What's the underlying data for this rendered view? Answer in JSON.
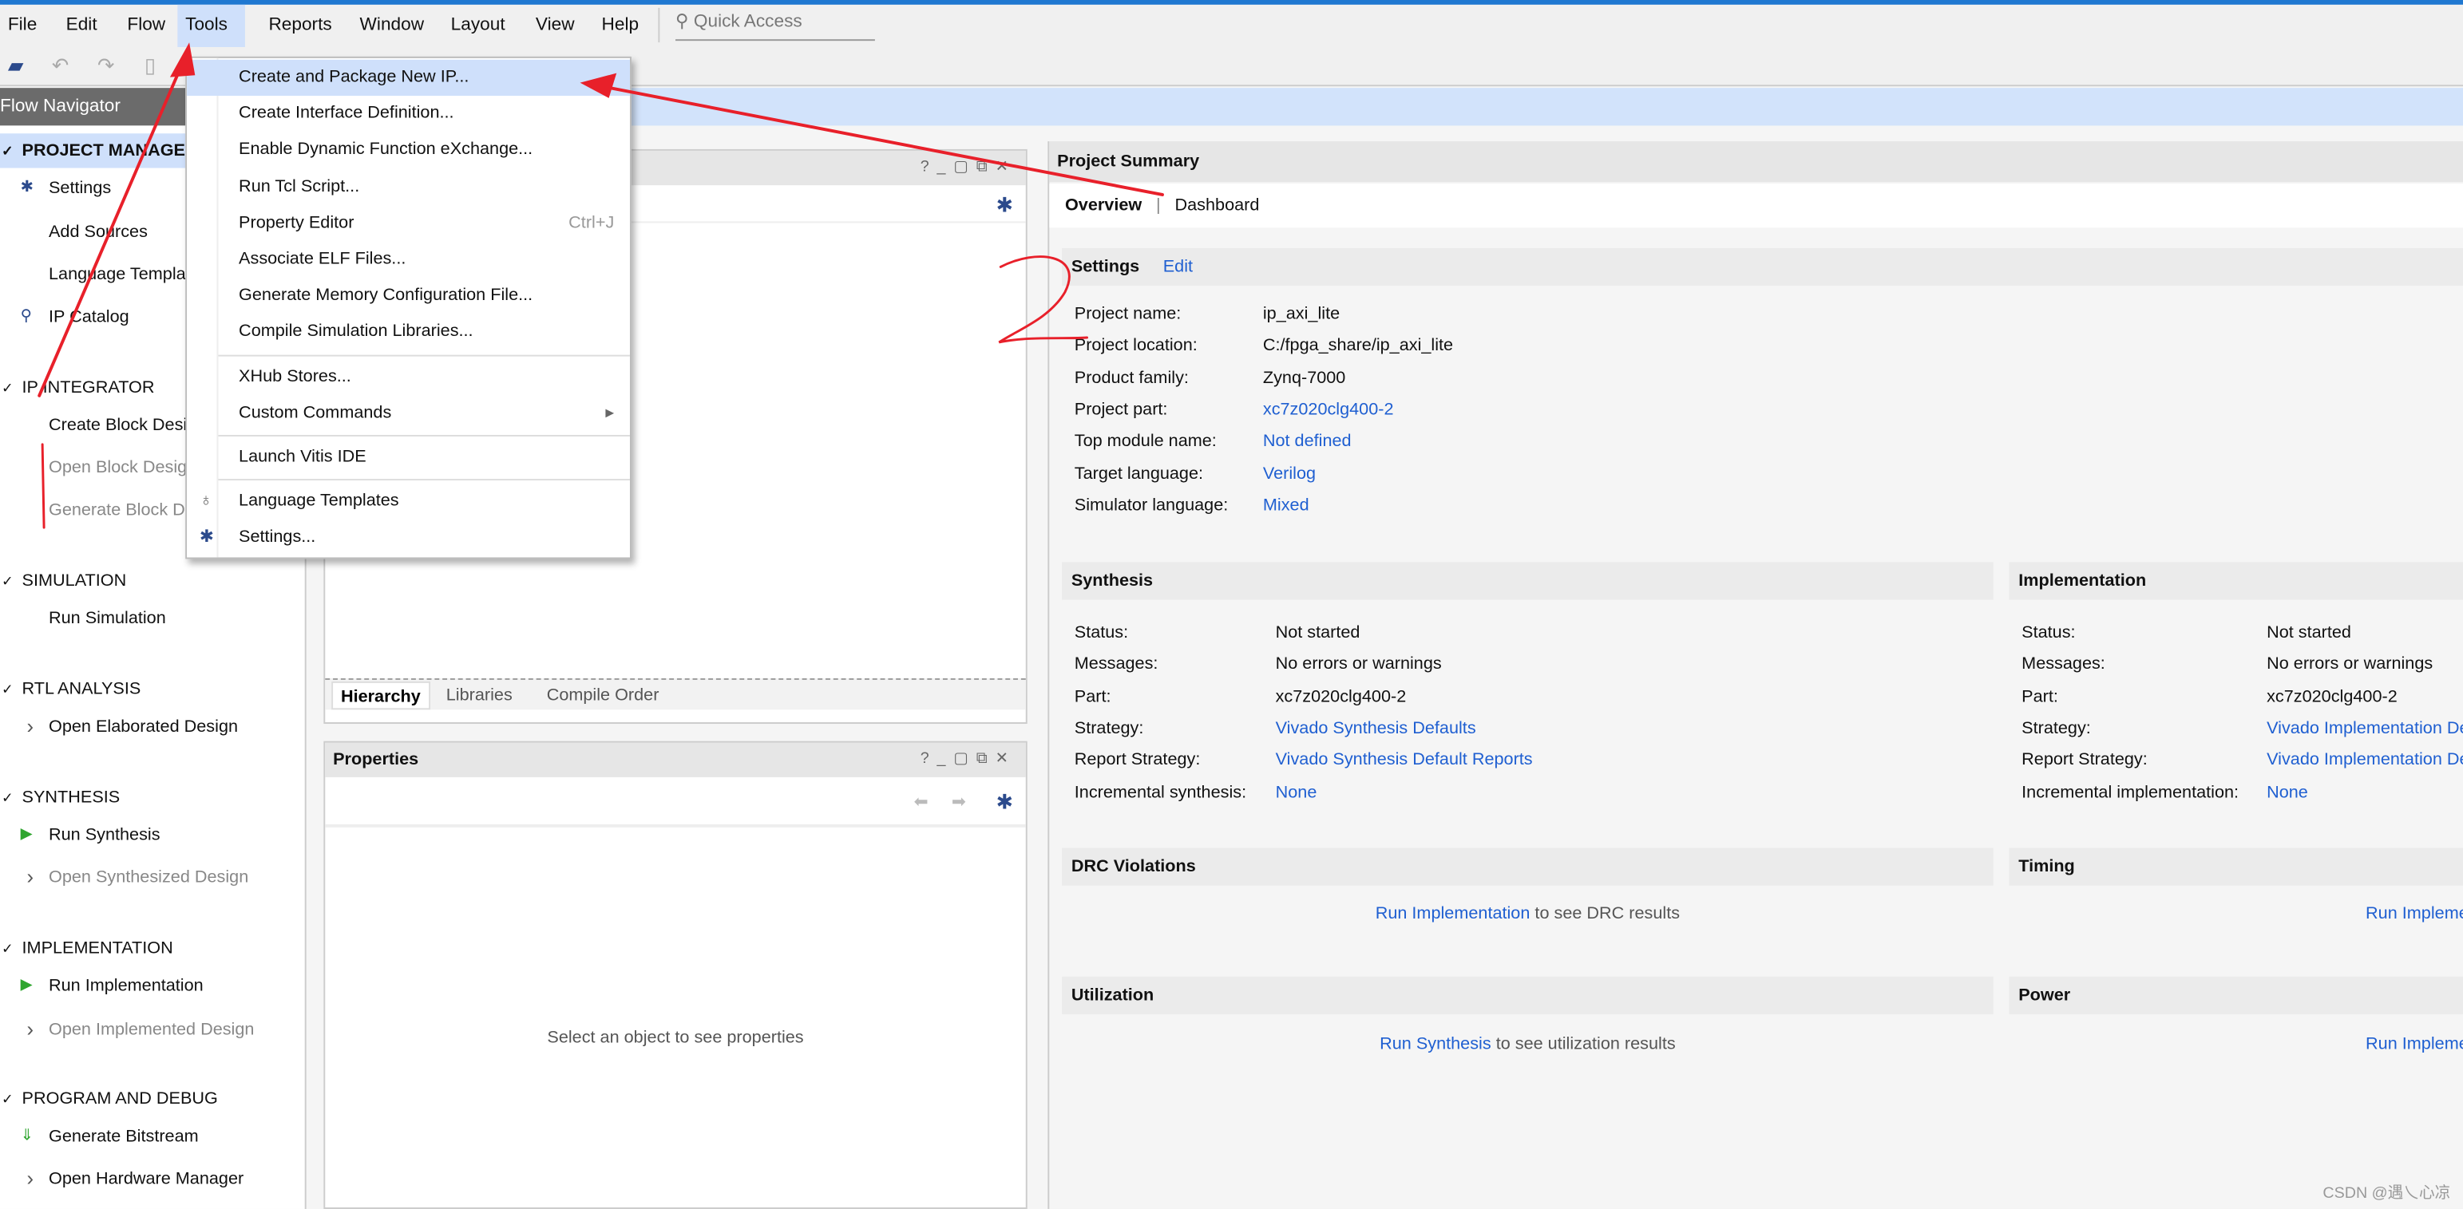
{
  "menubar": {
    "items": [
      "File",
      "Edit",
      "Flow",
      "Tools",
      "Reports",
      "Window",
      "Layout",
      "View",
      "Help"
    ],
    "active": "Tools",
    "quick_access_placeholder": "Quick Access"
  },
  "flow_navigator": {
    "title": "Flow Navigator",
    "items": [
      {
        "label": "PROJECT MANAGER",
        "kind": "section",
        "highlight": true
      },
      {
        "label": "Settings",
        "kind": "sub",
        "icon": "gear-icon"
      },
      {
        "label": "Add Sources",
        "kind": "sub"
      },
      {
        "label": "Language Templates",
        "kind": "sub"
      },
      {
        "label": "IP Catalog",
        "kind": "sub",
        "icon": "ip-catalog-icon"
      },
      {
        "label": "IP INTEGRATOR",
        "kind": "section"
      },
      {
        "label": "Create Block Design",
        "kind": "sub"
      },
      {
        "label": "Open Block Design",
        "kind": "sub",
        "disabled": true
      },
      {
        "label": "Generate Block Design",
        "kind": "sub",
        "disabled": true
      },
      {
        "label": "SIMULATION",
        "kind": "section"
      },
      {
        "label": "Run Simulation",
        "kind": "sub"
      },
      {
        "label": "RTL ANALYSIS",
        "kind": "section"
      },
      {
        "label": "Open Elaborated Design",
        "kind": "sub",
        "icon": "chevron-right-icon"
      },
      {
        "label": "SYNTHESIS",
        "kind": "section"
      },
      {
        "label": "Run Synthesis",
        "kind": "sub",
        "icon": "play-icon"
      },
      {
        "label": "Open Synthesized Design",
        "kind": "sub",
        "icon": "chevron-right-icon",
        "disabled": true
      },
      {
        "label": "IMPLEMENTATION",
        "kind": "section"
      },
      {
        "label": "Run Implementation",
        "kind": "sub",
        "icon": "play-icon"
      },
      {
        "label": "Open Implemented Design",
        "kind": "sub",
        "icon": "chevron-right-icon",
        "disabled": true
      },
      {
        "label": "PROGRAM AND DEBUG",
        "kind": "section"
      },
      {
        "label": "Generate Bitstream",
        "kind": "sub",
        "icon": "bitstream-icon"
      },
      {
        "label": "Open Hardware Manager",
        "kind": "sub",
        "icon": "chevron-right-icon"
      }
    ]
  },
  "sources": {
    "tabs": [
      "Hierarchy",
      "Libraries",
      "Compile Order"
    ],
    "selected_tab": "Hierarchy"
  },
  "properties": {
    "title": "Properties",
    "empty_text": "Select an object to see properties"
  },
  "tools_menu": {
    "items": [
      {
        "label": "Create and Package New IP...",
        "highlight": true
      },
      {
        "label": "Create Interface Definition..."
      },
      {
        "label": "Enable Dynamic Function eXchange..."
      },
      {
        "label": "Run Tcl Script..."
      },
      {
        "label": "Property Editor",
        "shortcut": "Ctrl+J"
      },
      {
        "label": "Associate ELF Files..."
      },
      {
        "label": "Generate Memory Configuration File..."
      },
      {
        "label": "Compile Simulation Libraries...",
        "sep_after": true
      },
      {
        "label": "XHub Stores..."
      },
      {
        "label": "Custom Commands",
        "submenu": true,
        "sep_after": true
      },
      {
        "label": "Launch Vitis IDE",
        "sep_after": true
      },
      {
        "label": "Language Templates",
        "icon": "lightbulb-icon"
      },
      {
        "label": "Settings...",
        "icon": "gear-icon"
      }
    ]
  },
  "project_summary": {
    "title": "Project Summary",
    "tabs": [
      "Overview",
      "Dashboard"
    ],
    "settings": {
      "title": "Settings",
      "edit": "Edit",
      "rows": [
        {
          "k": "Project name:",
          "v": "ip_axi_lite"
        },
        {
          "k": "Project location:",
          "v": "C:/fpga_share/ip_axi_lite"
        },
        {
          "k": "Product family:",
          "v": "Zynq-7000"
        },
        {
          "k": "Project part:",
          "v": "xc7z020clg400-2",
          "link": true
        },
        {
          "k": "Top module name:",
          "v": "Not defined",
          "link": true
        },
        {
          "k": "Target language:",
          "v": "Verilog",
          "link": true
        },
        {
          "k": "Simulator language:",
          "v": "Mixed",
          "link": true
        }
      ]
    },
    "synthesis": {
      "title": "Synthesis",
      "rows": [
        {
          "k": "Status:",
          "v": "Not started"
        },
        {
          "k": "Messages:",
          "v": "No errors or warnings"
        },
        {
          "k": "Part:",
          "v": "xc7z020clg400-2"
        },
        {
          "k": "Strategy:",
          "v": "Vivado Synthesis Defaults",
          "link": true
        },
        {
          "k": "Report Strategy:",
          "v": "Vivado Synthesis Default Reports",
          "link": true
        },
        {
          "k": "Incremental synthesis:",
          "v": "None",
          "link": true
        }
      ]
    },
    "implementation": {
      "title": "Implementation",
      "rows": [
        {
          "k": "Status:",
          "v": "Not started"
        },
        {
          "k": "Messages:",
          "v": "No errors or warnings"
        },
        {
          "k": "Part:",
          "v": "xc7z020clg400-2"
        },
        {
          "k": "Strategy:",
          "v": "Vivado Implementation Defaults",
          "link": true
        },
        {
          "k": "Report Strategy:",
          "v": "Vivado Implementation Default Reports",
          "link": true
        },
        {
          "k": "Incremental implementation:",
          "v": "None",
          "link": true
        }
      ]
    },
    "drc": {
      "title": "DRC Violations",
      "link": "Run Implementation",
      "text": "to see DRC results"
    },
    "timing": {
      "title": "Timing",
      "link": "Run Implementation"
    },
    "utilization": {
      "title": "Utilization",
      "link": "Run Synthesis",
      "text": "to see utilization results"
    },
    "power": {
      "title": "Power",
      "link": "Run Implementation"
    }
  },
  "annotation": {
    "number": "2",
    "color": "#e8202a"
  },
  "watermark": "CSDN @遇乀心凉",
  "colors": {
    "accent": "#1f78d1",
    "highlight": "#cfe0fb",
    "link": "#1f5fd1",
    "run_green": "#2fa52f"
  }
}
